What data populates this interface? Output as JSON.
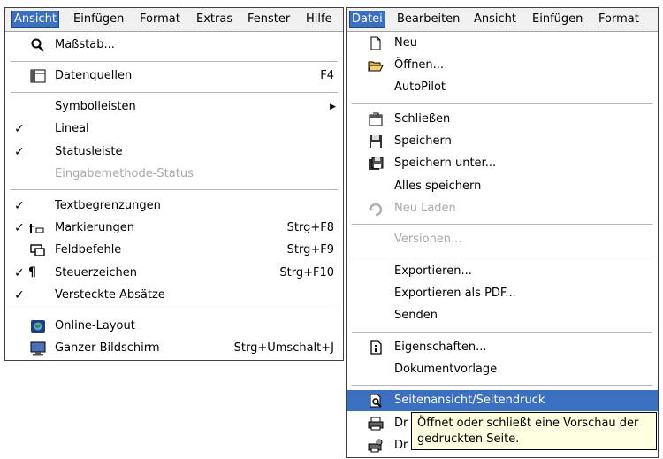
{
  "left_menu": {
    "menubar": [
      {
        "label": "Ansicht",
        "active": true
      },
      {
        "label": "Einfügen"
      },
      {
        "label": "Format"
      },
      {
        "label": "Extras"
      },
      {
        "label": "Fenster"
      },
      {
        "label": "Hilfe"
      }
    ],
    "items": [
      {
        "label": "Maßstab...",
        "icon": "zoom-icon"
      },
      {
        "label": "Datenquellen",
        "shortcut": "F4",
        "icon": "data-sources-icon"
      },
      {
        "label": "Symbolleisten",
        "submenu": true
      },
      {
        "label": "Lineal",
        "checked": true
      },
      {
        "label": "Statusleiste",
        "checked": true
      },
      {
        "label": "Eingabemethode-Status",
        "disabled": true
      },
      {
        "label": "Textbegrenzungen",
        "checked": true
      },
      {
        "label": "Markierungen",
        "shortcut": "Strg+F8",
        "checked": true,
        "icon": "field-shadings-icon"
      },
      {
        "label": "Feldbefehle",
        "shortcut": "Strg+F9",
        "icon": "fields-icon"
      },
      {
        "label": "Steuerzeichen",
        "shortcut": "Strg+F10",
        "checked": true,
        "icon": "pilcrow-icon"
      },
      {
        "label": "Versteckte Absätze",
        "checked": true
      },
      {
        "label": "Online-Layout",
        "icon": "web-layout-icon"
      },
      {
        "label": "Ganzer Bildschirm",
        "shortcut": "Strg+Umschalt+J",
        "icon": "full-screen-icon"
      }
    ]
  },
  "right_menu": {
    "menubar": [
      {
        "label": "Datei",
        "active": true
      },
      {
        "label": "Bearbeiten"
      },
      {
        "label": "Ansicht"
      },
      {
        "label": "Einfügen"
      },
      {
        "label": "Format"
      }
    ],
    "items": [
      {
        "label": "Neu",
        "icon": "new-document-icon"
      },
      {
        "label": "Öffnen...",
        "icon": "open-folder-icon"
      },
      {
        "label": "AutoPilot"
      },
      {
        "label": "Schließen",
        "icon": "close-document-icon"
      },
      {
        "label": "Speichern",
        "icon": "save-icon"
      },
      {
        "label": "Speichern unter...",
        "icon": "save-as-icon"
      },
      {
        "label": "Alles speichern"
      },
      {
        "label": "Neu Laden",
        "disabled": true,
        "icon": "reload-icon"
      },
      {
        "label": "Versionen...",
        "disabled": true
      },
      {
        "label": "Exportieren..."
      },
      {
        "label": "Exportieren als PDF..."
      },
      {
        "label": "Senden"
      },
      {
        "label": "Eigenschaften...",
        "icon": "properties-icon"
      },
      {
        "label": "Dokumentvorlage"
      },
      {
        "label": "Seitenansicht/Seitendruck",
        "highlight": true,
        "icon": "page-preview-icon"
      },
      {
        "label": "Dr",
        "icon": "print-icon"
      },
      {
        "label": "Dr",
        "icon": "printer-settings-icon"
      }
    ],
    "tooltip": {
      "line1": "Öffnet oder schließt eine Vorschau der",
      "line2": "gedruckten Seite."
    }
  },
  "colors": {
    "highlight": "#3b6fc0",
    "tooltip_bg": "#ffffe1",
    "disabled_text": "#a8a8a8"
  }
}
